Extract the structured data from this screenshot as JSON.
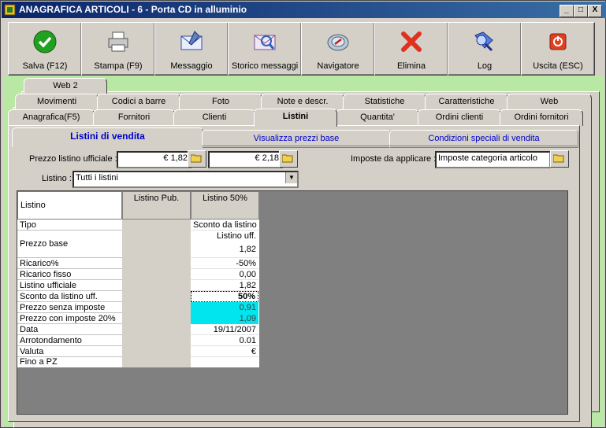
{
  "window": {
    "title": "ANAGRAFICA ARTICOLI - 6 - Porta CD in alluminio",
    "controls": {
      "minimize": "_",
      "maximize": "□",
      "close": "X"
    }
  },
  "toolbar": [
    {
      "label": "Salva (F12)",
      "icon": "check-icon"
    },
    {
      "label": "Stampa (F9)",
      "icon": "printer-icon"
    },
    {
      "label": "Messaggio",
      "icon": "envelope-icon"
    },
    {
      "label": "Storico messaggi",
      "icon": "message-history-icon"
    },
    {
      "label": "Navigatore",
      "icon": "navigator-icon"
    },
    {
      "label": "Elimina",
      "icon": "delete-icon"
    },
    {
      "label": "Log",
      "icon": "log-icon"
    },
    {
      "label": "Uscita (ESC)",
      "icon": "exit-icon"
    }
  ],
  "tabs": {
    "row1": [
      "Web 2"
    ],
    "row2": [
      "Movimenti",
      "Codici a barre",
      "Foto",
      "Note e descr.",
      "Statistiche",
      "Caratteristiche",
      "Web"
    ],
    "row3": [
      "Anagrafica(F5)",
      "Fornitori",
      "Clienti",
      "Listini",
      "Quantita'",
      "Ordini clienti",
      "Ordini fornitori"
    ],
    "active": "Listini"
  },
  "subtabs": [
    "Listini di vendita",
    "Visualizza prezzi base",
    "Condizioni speciali di vendita"
  ],
  "form": {
    "prezzo_label": "Prezzo listino ufficiale :",
    "prezzo_value1": "€ 1,82",
    "prezzo_value2": "€ 2,18",
    "imposte_label": "Imposte da applicare :",
    "imposte_value": "Imposte categoria articolo",
    "listino_label": "Listino :",
    "listino_value": "Tutti i listini"
  },
  "grid": {
    "headers": [
      "Listino",
      "Listino Pub.",
      "Listino 50%"
    ],
    "rows": [
      {
        "label": "Tipo",
        "pub": "",
        "val": "Sconto da listino"
      },
      {
        "label": "Prezzo base",
        "pub": "",
        "val": "Listino uff.",
        "val2": "1,82"
      },
      {
        "label": "Ricarico%",
        "pub": "",
        "val": "-50%"
      },
      {
        "label": "Ricarico fisso",
        "pub": "",
        "val": "0,00"
      },
      {
        "label": "Listino ufficiale",
        "pub": "",
        "val": "1,82"
      },
      {
        "label": "Sconto da listino uff.",
        "pub": "",
        "val": "50%"
      },
      {
        "label": "Prezzo senza imposte",
        "pub": "",
        "val": "0,91"
      },
      {
        "label": "Prezzo con imposte 20%",
        "pub": "",
        "val": "1,09"
      },
      {
        "label": "Data",
        "pub": "",
        "val": "19/11/2007"
      },
      {
        "label": "Arrotondamento",
        "pub": "",
        "val": "0.01"
      },
      {
        "label": "Valuta",
        "pub": "",
        "val": "€"
      },
      {
        "label": "Fino a PZ",
        "pub": "",
        "val": ""
      }
    ]
  },
  "colors": {
    "highlight": "#00e5ee",
    "green_bg": "#b8e8a4",
    "title_bar": "#0a246a"
  }
}
